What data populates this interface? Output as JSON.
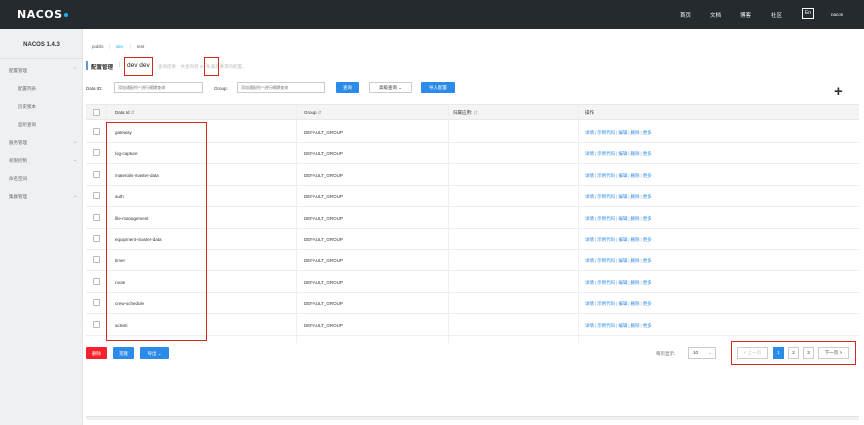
{
  "topbar": {
    "logo": "NACOS",
    "nav": [
      "首页",
      "文档",
      "博客",
      "社区"
    ],
    "lang": "En",
    "user": "nacos"
  },
  "sidebar": {
    "title": "NACOS 1.4.3",
    "items": [
      {
        "label": "配置管理",
        "type": "top",
        "expandable": true
      },
      {
        "label": "配置列表",
        "type": "sub"
      },
      {
        "label": "历史版本",
        "type": "sub"
      },
      {
        "label": "监听查询",
        "type": "sub"
      },
      {
        "label": "服务管理",
        "type": "top",
        "expandable": true
      },
      {
        "label": "权限控制",
        "type": "top",
        "expandable": true
      },
      {
        "label": "命名空间",
        "type": "top",
        "expandable": false
      },
      {
        "label": "集群管理",
        "type": "top",
        "expandable": true
      }
    ]
  },
  "breadcrumb": {
    "items": [
      "public",
      "dev",
      "test"
    ],
    "active": "dev"
  },
  "header": {
    "title": "配置管理",
    "namespace": "dev  dev",
    "hint": "查询结果：共查询到  20  条满足要求的配置。"
  },
  "filters": {
    "data_id_label": "Data ID:",
    "data_id_placeholder": "添加通配符'*'进行模糊查询",
    "group_label": "Group:",
    "group_placeholder": "添加通配符'*'进行模糊查询",
    "search_btn": "查询",
    "advanced_btn": "高级查询",
    "import_btn": "导入配置",
    "add_icon": "+"
  },
  "table": {
    "headers": [
      "Data Id",
      "Group",
      "归属应用:",
      "操作"
    ],
    "sort_icon": "⇵",
    "rows": [
      {
        "data_id": "gateway",
        "group": "DEFAULT_GROUP"
      },
      {
        "data_id": "log-capture",
        "group": "DEFAULT_GROUP"
      },
      {
        "data_id": "materials-master-data",
        "group": "DEFAULT_GROUP"
      },
      {
        "data_id": "auth",
        "group": "DEFAULT_GROUP"
      },
      {
        "data_id": "file-management",
        "group": "DEFAULT_GROUP"
      },
      {
        "data_id": "equipment-master-data",
        "group": "DEFAULT_GROUP"
      },
      {
        "data_id": "timer",
        "group": "DEFAULT_GROUP"
      },
      {
        "data_id": "route",
        "group": "DEFAULT_GROUP"
      },
      {
        "data_id": "crew-schedule",
        "group": "DEFAULT_GROUP"
      },
      {
        "data_id": "activiti",
        "group": "DEFAULT_GROUP"
      }
    ],
    "ops": [
      "详情",
      "示例代码",
      "编辑",
      "删除",
      "更多"
    ]
  },
  "footer": {
    "delete_btn": "删除",
    "clone_btn": "克隆",
    "export_btn": "导出",
    "page_size_label": "每页显示:",
    "page_size": "10",
    "prev": "< 上一页",
    "pages": [
      "1",
      "2",
      "3"
    ],
    "current_page": "1",
    "next": "下一页 >"
  },
  "colors": {
    "accent": "#2c8be8",
    "danger": "#f5222d",
    "topbar": "#252a2f",
    "highlight": "#d9251d"
  }
}
